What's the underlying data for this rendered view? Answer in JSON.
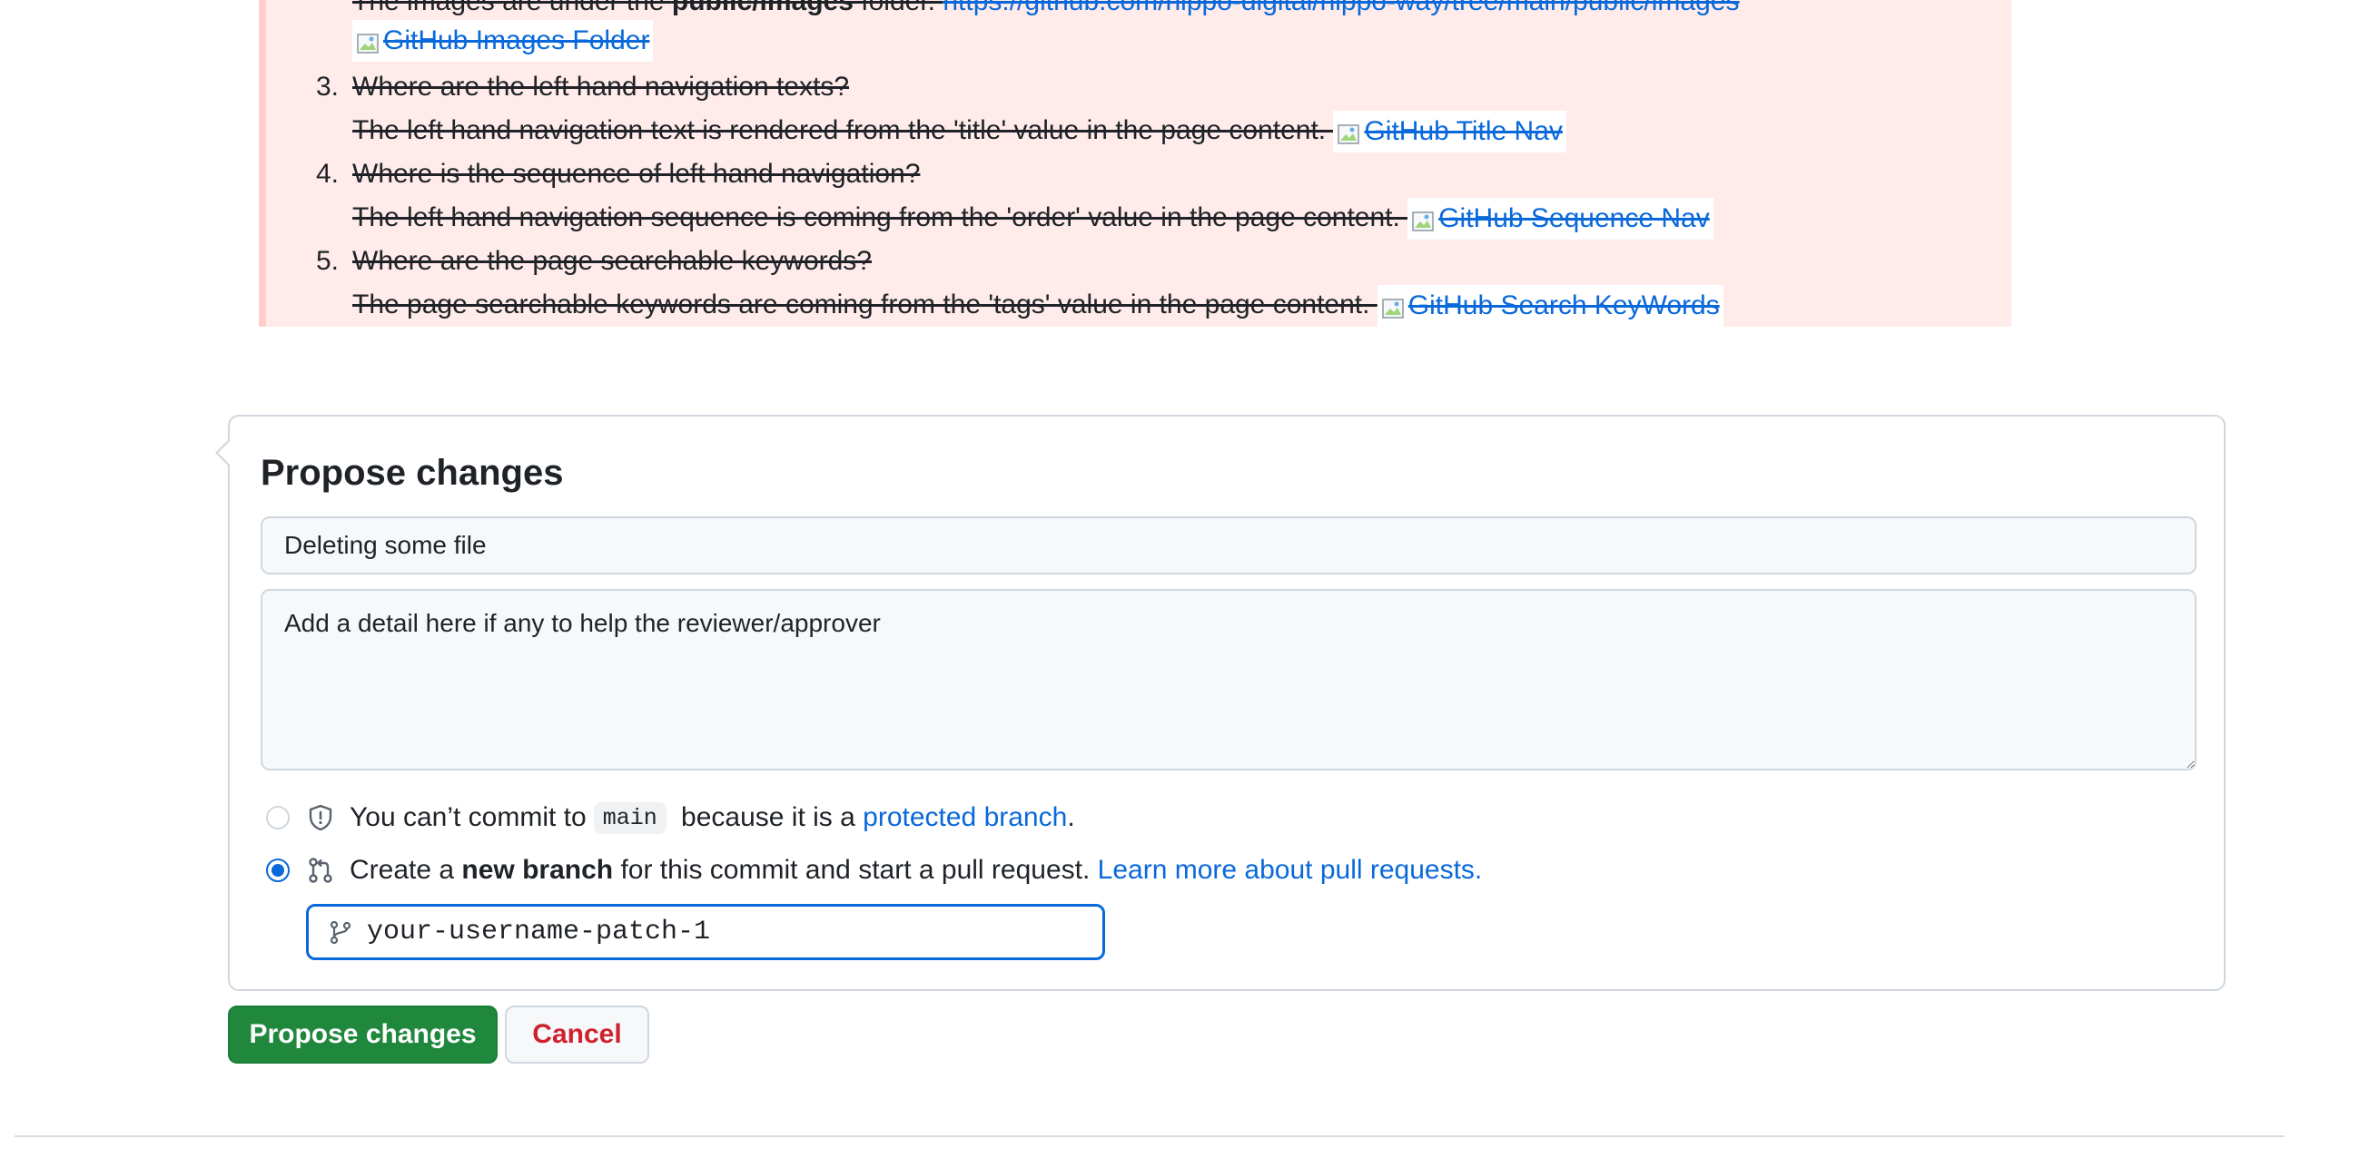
{
  "diff": {
    "line_images_prefix": "The images are under the ",
    "line_images_bold": "public/images",
    "line_images_suffix": " folder. ",
    "line_images_link": "https://github.com/hippo-digital/hippo-way/tree/main/public/images",
    "img_folder_alt": "GitHub Images Folder",
    "items": [
      {
        "num": "3.",
        "question": "Where are the left hand navigation texts?",
        "answer": "The left hand navigation text is rendered from the 'title' value in the page content. ",
        "img_alt": "GitHub Title Nav"
      },
      {
        "num": "4.",
        "question": "Where is the sequence of left hand navigation?",
        "answer": "The left hand navigation sequence is coming from the 'order' value in the page content. ",
        "img_alt": "GitHub Sequence Nav"
      },
      {
        "num": "5.",
        "question": "Where are the page searchable keywords?",
        "answer": "The page searchable keywords are coming from the 'tags' value in the page content. ",
        "img_alt": "GitHub Search KeyWords"
      }
    ]
  },
  "propose": {
    "title": "Propose changes",
    "summary_value": "Deleting some file",
    "description_placeholder": "Add a detail here if any to help the reviewer/approver",
    "option_protected": {
      "prefix": "You can’t commit to ",
      "branch": "main",
      "middle": " because it is a ",
      "link": "protected branch",
      "suffix": "."
    },
    "option_new_branch": {
      "prefix": "Create a ",
      "bold": "new branch",
      "middle": " for this commit and start a pull request. ",
      "link": "Learn more about pull requests."
    },
    "branch_name_value": "your-username-patch-1"
  },
  "actions": {
    "propose_label": "Propose changes",
    "cancel_label": "Cancel"
  },
  "colors": {
    "deleted_bg": "#ffebe9",
    "link": "#0969da",
    "primary_button": "#1f883d",
    "cancel_text": "#cf222e"
  },
  "icons": {
    "broken_image": "broken-image-icon",
    "shield": "shield-icon",
    "pull_request": "git-pull-request-icon",
    "branch": "git-branch-icon"
  }
}
